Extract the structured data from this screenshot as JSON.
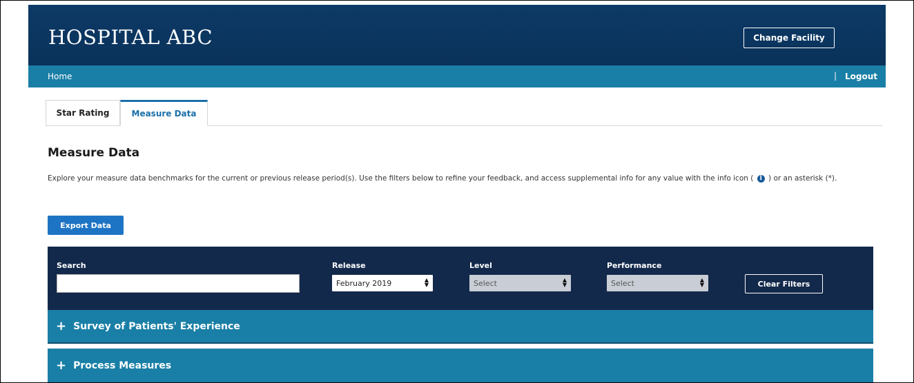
{
  "header": {
    "brand": "HOSPITAL ABC",
    "change_facility_label": "Change Facility"
  },
  "navbar": {
    "home_label": "Home",
    "separator": "|",
    "logout_label": "Logout"
  },
  "tabs": [
    {
      "label": "Star Rating",
      "active": false
    },
    {
      "label": "Measure Data",
      "active": true
    }
  ],
  "main": {
    "title": "Measure Data",
    "description_part1": "Explore your measure data benchmarks for the current or previous release period(s). Use the filters below to refine your feedback, and access supplemental info for any value with the info icon (",
    "description_part2": ") or an asterisk (*).",
    "info_icon_glyph": "i",
    "export_label": "Export Data"
  },
  "filters": {
    "search_label": "Search",
    "search_value": "",
    "release_label": "Release",
    "release_value": "February 2019",
    "level_label": "Level",
    "level_value": "Select",
    "performance_label": "Performance",
    "performance_value": "Select",
    "clear_label": "Clear Filters"
  },
  "sections": [
    {
      "label": "Survey of Patients' Experience",
      "expand_glyph": "+"
    },
    {
      "label": "Process Measures",
      "expand_glyph": "+"
    }
  ],
  "colors": {
    "header_bg": "#0d3a66",
    "navbar_bg": "#1a7fa6",
    "filter_bg": "#13294b",
    "accent_blue": "#1e74c4",
    "active_tab": "#1a6fa8"
  },
  "icons": {
    "info": "info-icon",
    "select_arrows": "sort-arrows-icon",
    "expand": "plus-icon"
  }
}
